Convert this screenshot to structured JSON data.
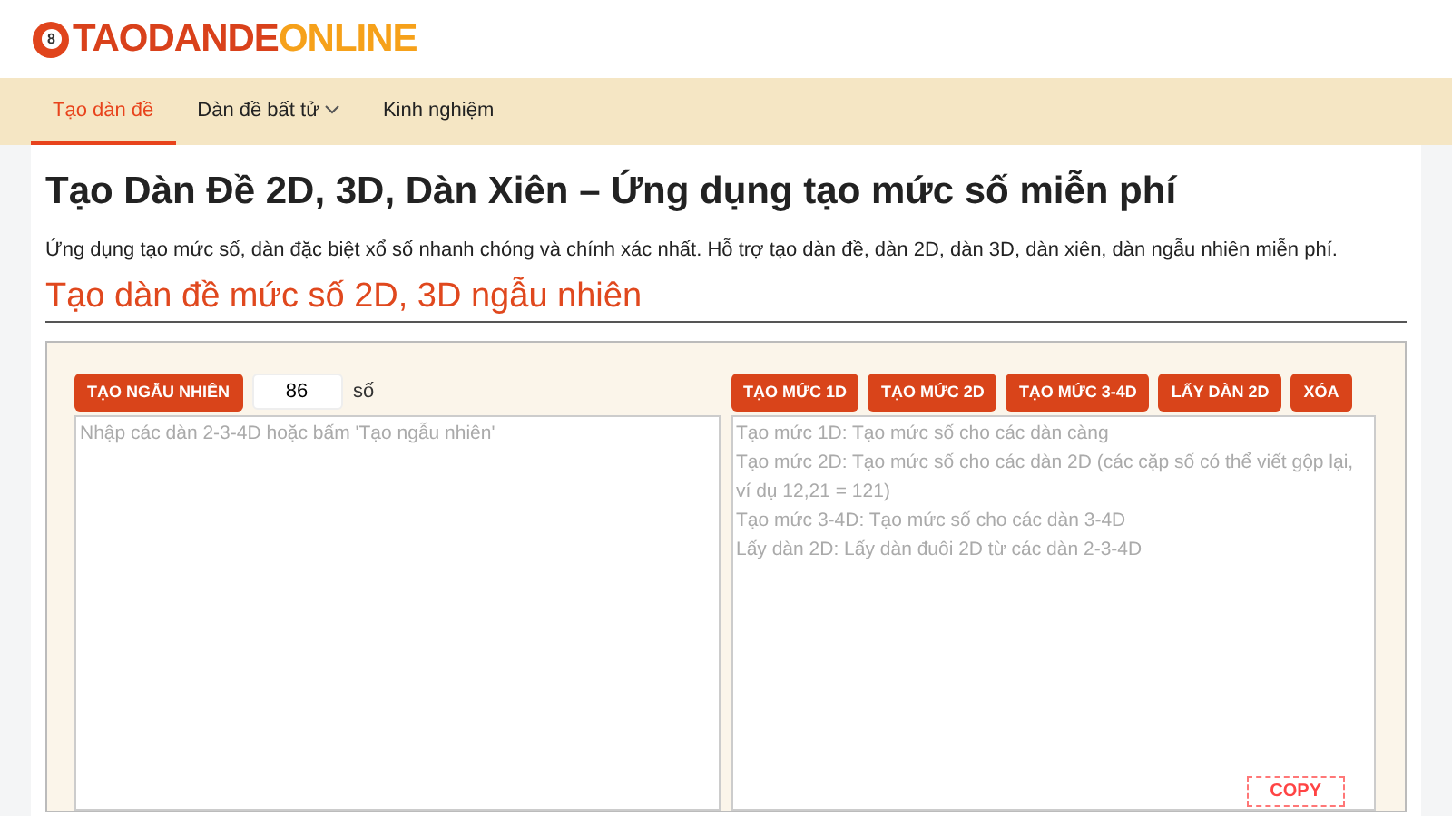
{
  "logo": {
    "part_1": "TAODANDE",
    "part_2": "ONLINE",
    "ball": "8"
  },
  "nav": [
    {
      "label": "Tạo dàn đề",
      "selected": true,
      "dropdown": false
    },
    {
      "label": "Dàn đề bất tử",
      "selected": false,
      "dropdown": true
    },
    {
      "label": "Kinh nghiệm",
      "selected": false,
      "dropdown": false
    }
  ],
  "title": "Tạo Dàn Đề 2D, 3D, Dàn Xiên – Ứng dụng tạo mức số miễn phí",
  "intro": "Ứng dụng tạo mức số, dàn đặc biệt xổ số nhanh chóng và chính xác nhất. Hỗ trợ tạo dàn đề, dàn 2D, dàn 3D, dàn xiên, dàn ngẫu nhiên miễn phí.",
  "section_title": "Tạo dàn đề mức số 2D, 3D ngẫu nhiên",
  "left": {
    "button": "TẠO NGẪU NHIÊN",
    "count": "86",
    "unit": "số",
    "placeholder": "Nhập các dàn 2-3-4D hoặc bấm 'Tạo ngẫu nhiên'"
  },
  "right": {
    "buttons": [
      "TẠO MỨC 1D",
      "TẠO MỨC 2D",
      "TẠO MỨC 3-4D",
      "LẤY DÀN 2D",
      "XÓA"
    ],
    "placeholder": "Tạo mức 1D: Tạo mức số cho các dàn càng\nTạo mức 2D: Tạo mức số cho các dàn 2D (các cặp số có thể viết gộp lại, ví dụ 12,21 = 121)\nTạo mức 3-4D: Tạo mức số cho các dàn 3-4D\nLấy dàn 2D: Lấy dàn đuôi 2D từ các dàn 2-3-4D",
    "copy": "COPY"
  }
}
